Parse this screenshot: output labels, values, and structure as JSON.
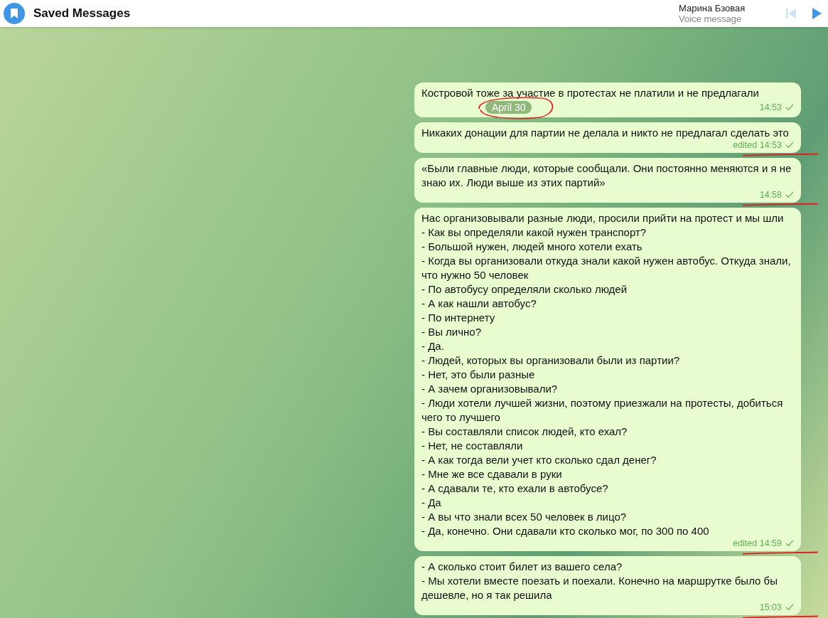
{
  "header": {
    "title": "Saved Messages",
    "player": {
      "name": "Марина Бзовая",
      "subtitle": "Voice message"
    }
  },
  "messages": [
    {
      "text": "Костровой тоже за участие в протестах не платили и не предлагали",
      "date_badge": {
        "label": "April 30",
        "circled": true
      },
      "time": "14:53",
      "underlined": false
    },
    {
      "text": "Никаких донации для партии не делала и никто не предлагал сделать это",
      "time": "edited 14:53",
      "underlined": true
    },
    {
      "text": "«Были главные люди, которые сообщали. Они постоянно меняются и я не знаю их. Люди выше из этих партий»",
      "time": "14:58",
      "underlined": true
    },
    {
      "text": "Нас организовывали разные люди, просили прийти на протест и мы шли\n- Как вы определяли какой нужен транспорт?\n- Большой нужен, людей много хотели ехать\n- Когда вы организовали откуда знали какой нужен автобус. Откуда знали, что нужно 50 человек\n- По автобусу определяли сколько людей\n- А как нашли автобус?\n- По интернету\n- Вы лично?\n- Да.\n- Людей, которых вы организовали были из партии?\n- Нет, это были разные\n- А зачем организовывали?\n- Люди хотели лучшей жизни, поэтому приезжали на протесты, добиться чего то лучшего\n- Вы составляли список людей, кто ехал?\n- Нет, не составляли\n- А как тогда вели учет кто сколько сдал денег?\n- Мне же все сдавали в руки\n- А сдавали те, кто ехали в автобусе?\n- Да\n- А вы что знали всех 50 человек в лицо?\n- Да, конечно. Они сдавали кто сколько мог, по 300 по 400",
      "time": "edited 14:59",
      "underlined": true
    },
    {
      "text": "- А сколько стоит билет из вашего села?\n- Мы хотели вместе поезать и поехали. Конечно на маршрутке было бы дешевле, но я так решила",
      "time": "15:03",
      "underlined": true
    }
  ]
}
